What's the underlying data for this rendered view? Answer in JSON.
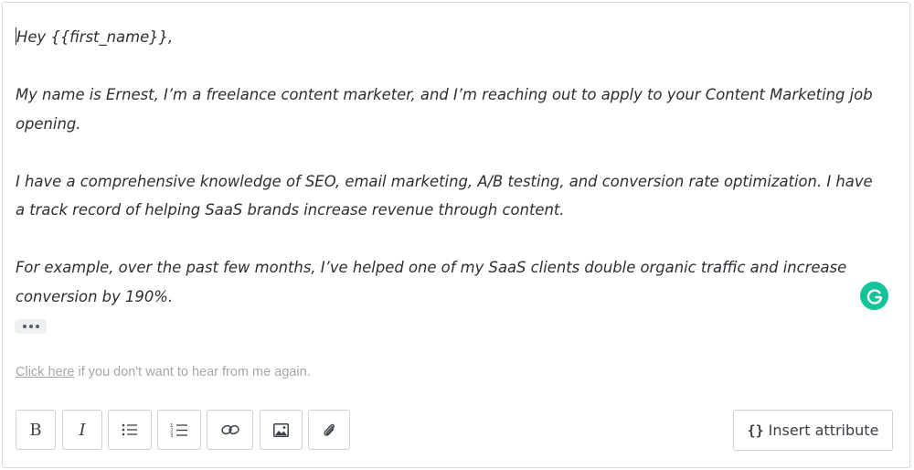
{
  "email": {
    "greeting": "Hey {{first_name}},",
    "paragraphs": [
      "My name is Ernest, I’m a freelance content marketer, and I’m reaching out to apply to your Content Marketing job opening.",
      "I have a comprehensive knowledge of SEO, email marketing, A/B testing, and conversion rate optimization. I have a track record of helping SaaS brands increase revenue through content.",
      "For example, over the past few months, I’ve helped one of my SaaS clients double organic traffic and increase conversion by 190%."
    ]
  },
  "unsubscribe": {
    "link_text": "Click here",
    "rest_text": " if you don't want to hear from me again."
  },
  "toolbar": {
    "bold_glyph": "B",
    "italic_glyph": "I",
    "buttons": [
      "bold",
      "italic",
      "bulleted-list",
      "numbered-list",
      "link",
      "image",
      "attachment"
    ],
    "insert_attribute_braces": "{}",
    "insert_attribute_label": "Insert attribute"
  },
  "colors": {
    "grammarly": "#15c39a",
    "text": "#2b2f33",
    "muted": "#a3a8ad",
    "border": "#cdd1d5"
  },
  "icons": {
    "grammarly": "grammarly-icon",
    "ellipsis": "more-dots-icon"
  }
}
